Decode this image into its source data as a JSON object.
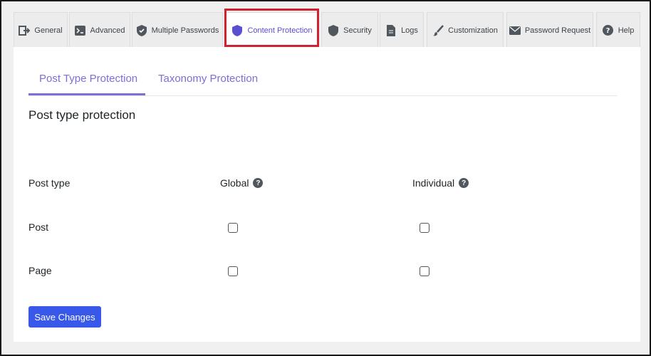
{
  "tabs": [
    {
      "label": "General",
      "icon": "exit-icon"
    },
    {
      "label": "Advanced",
      "icon": "terminal-icon"
    },
    {
      "label": "Multiple Passwords",
      "icon": "shield-check-icon"
    },
    {
      "label": "Content Protection",
      "icon": "shield-icon"
    },
    {
      "label": "Security",
      "icon": "shield-icon"
    },
    {
      "label": "Logs",
      "icon": "document-icon"
    },
    {
      "label": "Customization",
      "icon": "brush-icon"
    },
    {
      "label": "Password Request",
      "icon": "envelope-icon"
    },
    {
      "label": "Help",
      "icon": "help-icon"
    }
  ],
  "active_tab": "Content Protection",
  "subtabs": [
    {
      "label": "Post Type Protection"
    },
    {
      "label": "Taxonomy Protection"
    }
  ],
  "active_subtab": "Post Type Protection",
  "section_title": "Post type protection",
  "table": {
    "header_post_type": "Post type",
    "header_global": "Global",
    "header_individual": "Individual",
    "help_glyph": "?",
    "rows": [
      {
        "label": "Post",
        "global": false,
        "individual": false
      },
      {
        "label": "Page",
        "global": false,
        "individual": false
      }
    ]
  },
  "save_label": "Save Changes",
  "colors": {
    "accent": "#7c6fd6",
    "button": "#3858e9",
    "highlight": "#d1202f"
  }
}
